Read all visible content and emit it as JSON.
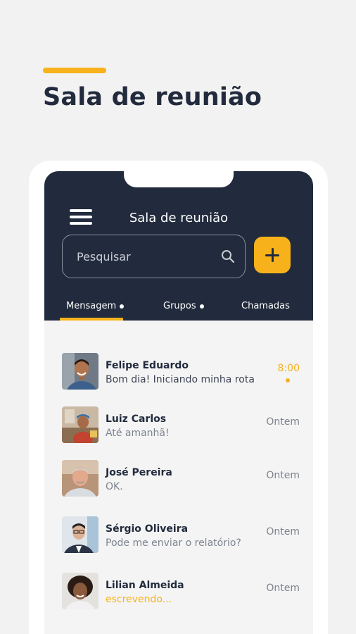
{
  "promo": {
    "headline": "Sala de reunião",
    "accent_color": "#f7b21b"
  },
  "app": {
    "title": "Sala de reunião",
    "menu_icon": "hamburger-menu-icon",
    "add_icon": "plus-icon",
    "search": {
      "placeholder": "Pesquisar",
      "value": "",
      "icon": "search-icon"
    },
    "tabs": [
      {
        "label": "Mensagem",
        "has_dot": true,
        "active": true
      },
      {
        "label": "Grupos",
        "has_dot": true,
        "active": false
      },
      {
        "label": "Chamadas",
        "has_dot": false,
        "active": false
      }
    ],
    "colors": {
      "header": "#222b3d",
      "accent": "#f7b21b",
      "background": "#f4f4f4"
    }
  },
  "conversations": [
    {
      "name": "Felipe Eduardo",
      "message": "Bom dia! Iniciando minha rota",
      "time": "8:00",
      "unread": true,
      "status": "unread"
    },
    {
      "name": "Luiz Carlos",
      "message": "Até amanhã!",
      "time": "Ontem",
      "unread": false,
      "status": "read"
    },
    {
      "name": "José Pereira",
      "message": "OK.",
      "time": "Ontem",
      "unread": false,
      "status": "read"
    },
    {
      "name": "Sérgio Oliveira",
      "message": "Pode me enviar o relatório?",
      "time": "Ontem",
      "unread": false,
      "status": "read"
    },
    {
      "name": "Lilian Almeida",
      "message": "escrevendo...",
      "time": "Ontem",
      "unread": false,
      "status": "typing"
    }
  ]
}
